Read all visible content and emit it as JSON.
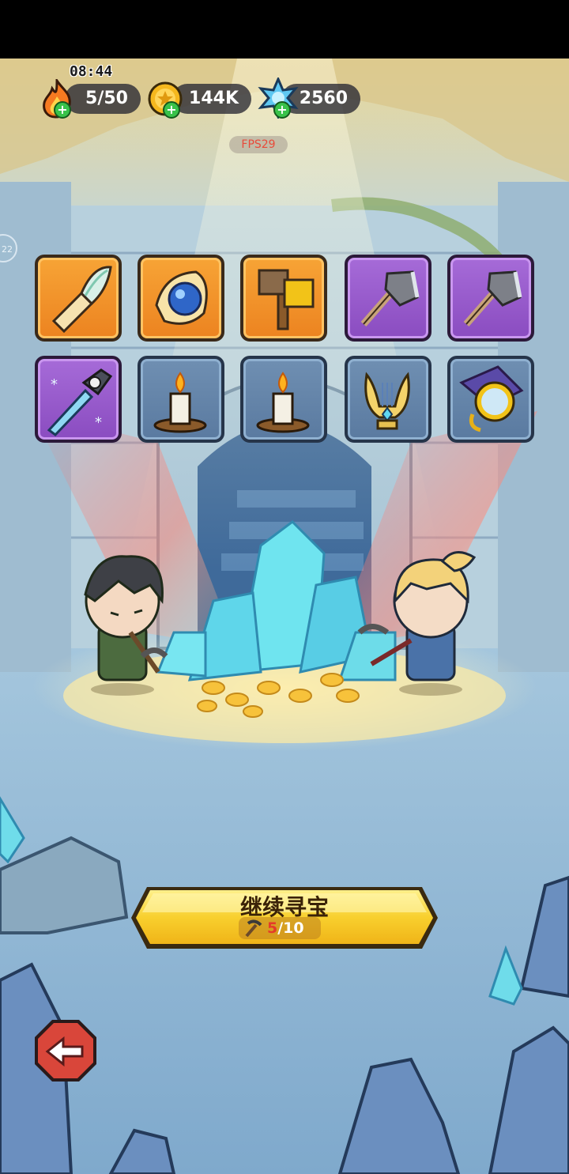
{
  "hud": {
    "time": "08:44",
    "energy": "5/50",
    "gold": "144K",
    "gems": "2560",
    "fps": "FPS29",
    "side_badge": "22",
    "icons": {
      "energy": "fire-icon",
      "gold": "gold-coin-icon",
      "gems": "blue-crystal-icon",
      "add": "plus-icon"
    }
  },
  "inventory": {
    "slots": [
      {
        "item": "feather-horn",
        "rarity": "orange"
      },
      {
        "item": "blue-orb-feather",
        "rarity": "orange"
      },
      {
        "item": "golden-hammer",
        "rarity": "orange"
      },
      {
        "item": "stone-axe",
        "rarity": "purple"
      },
      {
        "item": "stone-axe",
        "rarity": "purple"
      },
      {
        "item": "ice-dagger",
        "rarity": "purple"
      },
      {
        "item": "candle",
        "rarity": "blue"
      },
      {
        "item": "candle",
        "rarity": "blue"
      },
      {
        "item": "golden-lyre",
        "rarity": "blue"
      },
      {
        "item": "pocket-watch",
        "rarity": "blue"
      }
    ]
  },
  "actions": {
    "continue_label": "继续寻宝",
    "cost_used": "5",
    "cost_total": "/10",
    "cost_icon": "pickaxe-icon",
    "back_icon": "back-arrow-icon"
  },
  "colors": {
    "orange_slot": "#f2942c",
    "purple_slot": "#9a5ccc",
    "blue_slot": "#6585a9",
    "button_gold": "#f7cf2e"
  }
}
